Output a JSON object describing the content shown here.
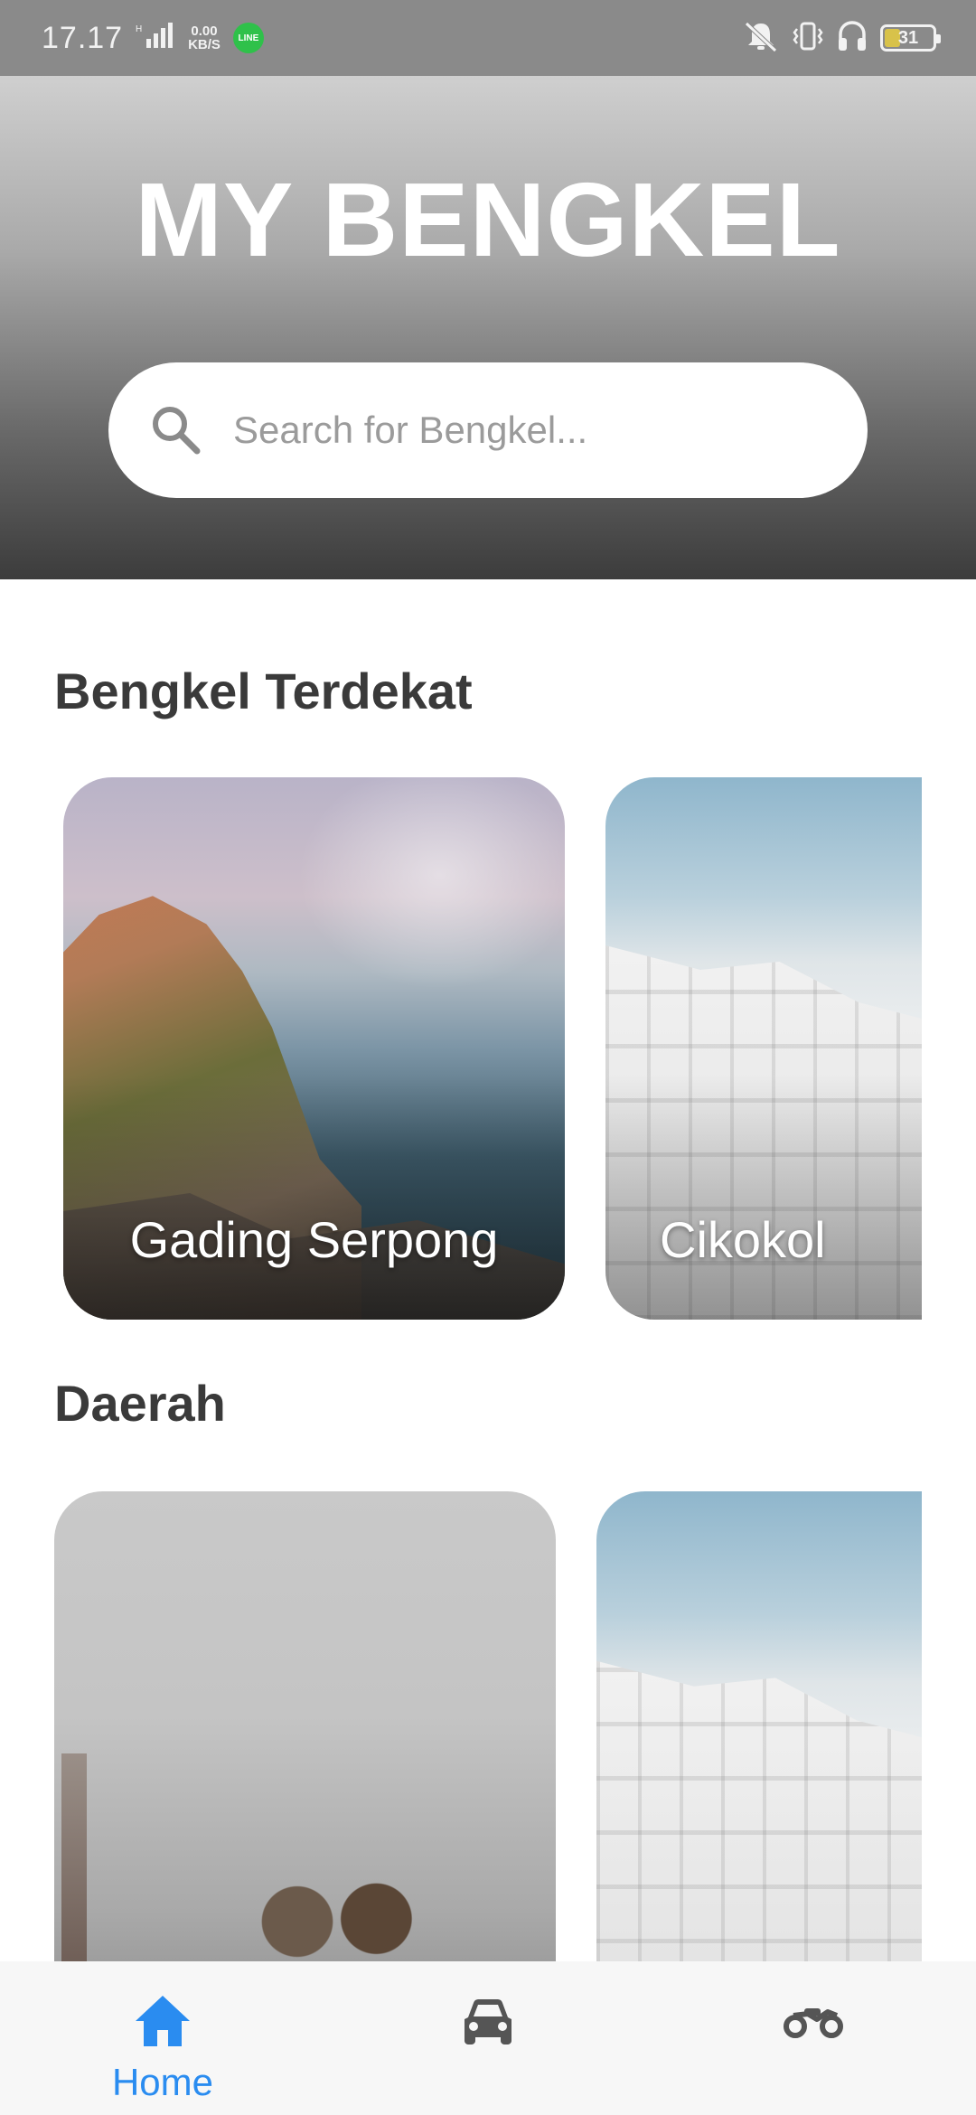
{
  "status_bar": {
    "time": "17.17",
    "net_speed_value": "0.00",
    "net_speed_unit": "KB/S",
    "battery_level": "31",
    "line_icon_text": "LINE"
  },
  "header": {
    "title": "MY BENGKEL"
  },
  "search": {
    "placeholder": "Search for Bengkel..."
  },
  "sections": {
    "nearby_title": "Bengkel Terdekat",
    "nearby_cards": [
      {
        "label": "Gading Serpong"
      },
      {
        "label": "Cikokol"
      }
    ],
    "area_title": "Daerah"
  },
  "bottom_nav": {
    "items": [
      {
        "label": "Home",
        "icon": "home-icon",
        "active": true
      },
      {
        "label": "",
        "icon": "car-icon",
        "active": false
      },
      {
        "label": "",
        "icon": "motorcycle-icon",
        "active": false
      }
    ]
  },
  "colors": {
    "accent": "#2a8cf0",
    "inactive_icon": "#555555"
  }
}
